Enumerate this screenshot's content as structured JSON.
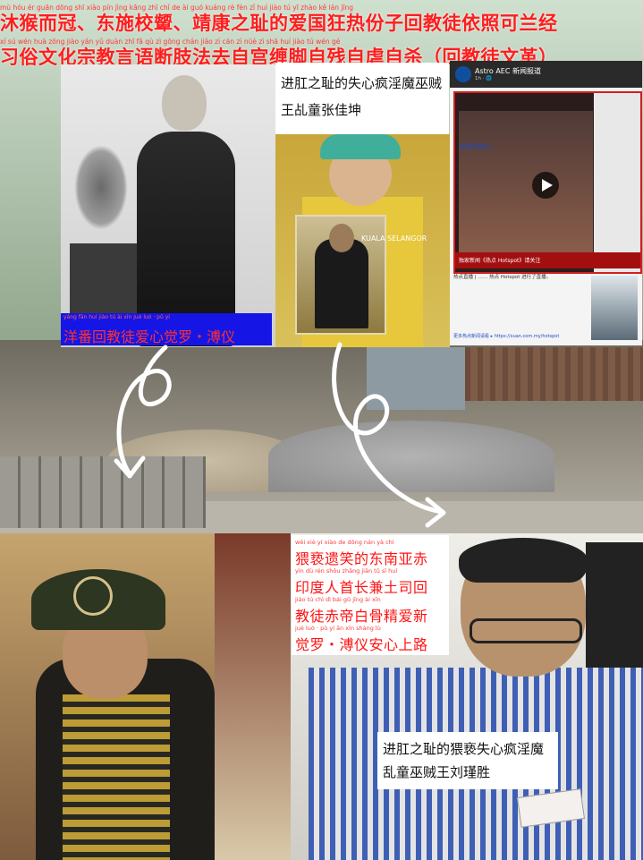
{
  "header": {
    "line1": {
      "text": "沐猴而冠、东施校颦、靖康之耻的爱国狂热份子回教徒依照可兰经",
      "pinyin": "mù hóu ér guān    dōng shī xiào pín     jìng kāng zhī chǐ de ài guó kuáng rè fèn zǐ huí jiào tú yī zhào kě lán jīng"
    },
    "line2": {
      "text": "习俗文化宗教言语断肢法去自宫缠脚自残自虐自杀（回教徒文革）",
      "pinyin": "xí sú wén huà zōng jiào yán yǔ duàn zhī fǎ qù zì gōng chán jiǎo zì cán zì nüè zì shā    huí jiào tú wén gé"
    }
  },
  "labels": {
    "ceremony": "进肛之耻的失心疯淫魔巫贼王乩童张佳坤",
    "puyi": "洋番回教徒爱心觉罗・溥仪",
    "puyi_pinyin": "yáng fān huí jiào tú ài xīn jué luó · pǔ yí",
    "bottom": "进肛之耻的猥亵失心疯淫魔乱童巫贼王刘瑾胜",
    "middle": [
      {
        "text": "猥亵遗笑的东南亚赤",
        "pinyin": "wěi xiè yí xiào de dōng nán yà chì"
      },
      {
        "text": "印度人首长兼土司回",
        "pinyin": "yìn dù rén shǒu zhǎng jiān tǔ sī huí"
      },
      {
        "text": "教徒赤帝白骨精爱新",
        "pinyin": "jiào tú chì dì bái gǔ jīng ài xīn"
      },
      {
        "text": "觉罗・溥仪安心上路",
        "pinyin": "jué luó · pǔ yí ān xīn shàng lù"
      }
    ]
  },
  "post": {
    "channel": "Astro AEC 新闻报道",
    "subtitle": "1h · 🌐",
    "video_overlay": "东姑阿都拉…",
    "video_caption": "独家新闻《热点 Hotspot》请关注",
    "body": "热点直播 | …… 热点 Hotspot 进行了直播。",
    "link": "更多热点新闻请看 ▸ https://xuan.com.my/hotspot",
    "inset_watermark": "KUALA SELANGOR"
  },
  "colors": {
    "header_red": "#ff1d1d",
    "label_blue": "#1515e6",
    "video_red": "#d21f1f"
  },
  "icons": [
    "play-icon",
    "curved-arrow-left",
    "curved-arrow-right"
  ]
}
